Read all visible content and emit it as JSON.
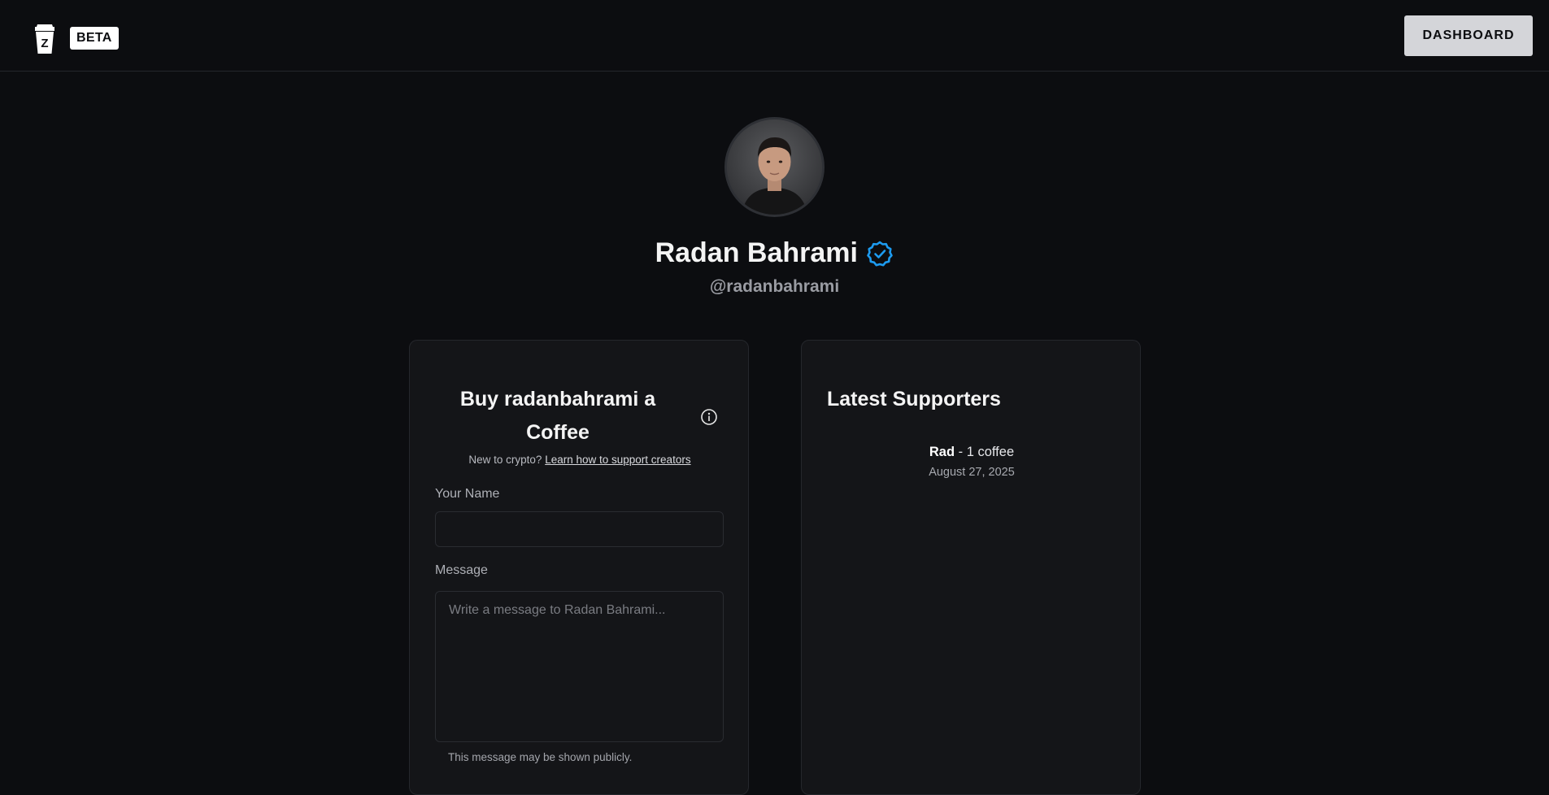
{
  "header": {
    "beta_label": "BETA",
    "dashboard_label": "DASHBOARD"
  },
  "profile": {
    "name": "Radan Bahrami",
    "handle": "@radanbahrami",
    "verified_color": "#1d9bf0"
  },
  "buy": {
    "title": "Buy radanbahrami a Coffee",
    "crypto_prefix": "New to crypto?",
    "crypto_link": "Learn how to support creators",
    "name_label": "Your Name",
    "name_value": "",
    "message_label": "Message",
    "message_placeholder": "Write a message to Radan Bahrami...",
    "public_note": "This message may be shown publicly."
  },
  "supporters": {
    "title": "Latest Supporters",
    "items": [
      {
        "name": "Rad",
        "detail": "- 1 coffee",
        "date": "August 27, 2025"
      }
    ]
  }
}
